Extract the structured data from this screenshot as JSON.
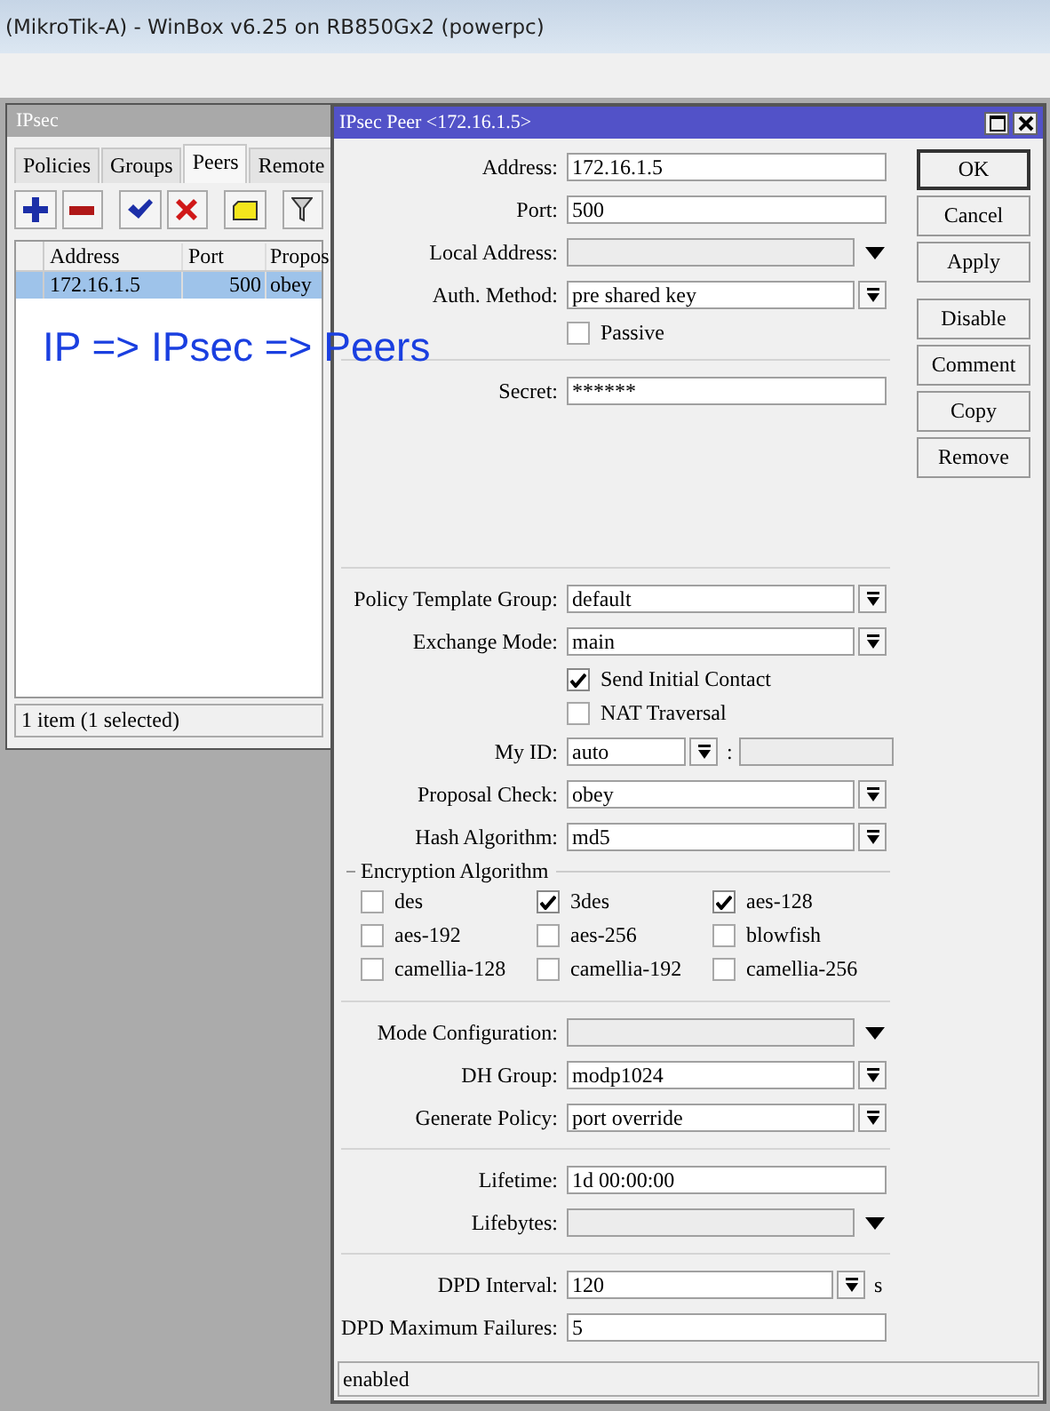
{
  "app_title": "(MikroTik-A) - WinBox v6.25 on RB850Gx2 (powerpc)",
  "ipsec_window": {
    "title": "IPsec",
    "tabs": [
      {
        "label": "Policies",
        "selected": false
      },
      {
        "label": "Groups",
        "selected": false
      },
      {
        "label": "Peers",
        "selected": true
      },
      {
        "label": "Remote",
        "selected": false
      }
    ],
    "columns": [
      "Address",
      "Port",
      "Propos"
    ],
    "rows": [
      {
        "cells": [
          "172.16.1.5",
          "500",
          "obey"
        ],
        "selected": true
      }
    ],
    "status": "1 item (1 selected)"
  },
  "annotation": "IP => IPsec => Peers",
  "peer_dialog": {
    "title": "IPsec Peer <172.16.1.5>",
    "fields": [
      {
        "kind": "input",
        "label": "Address:",
        "value": "172.16.1.5"
      },
      {
        "kind": "input",
        "label": "Port:",
        "value": "500"
      },
      {
        "kind": "combo",
        "label": "Local Address:"
      },
      {
        "kind": "select",
        "label": "Auth. Method:",
        "value": "pre shared key"
      },
      {
        "kind": "check",
        "label": "Passive",
        "checked": false
      },
      {
        "kind": "separator"
      },
      {
        "kind": "input",
        "label": "Secret:",
        "value": "******"
      },
      {
        "kind": "gap"
      },
      {
        "kind": "separator"
      },
      {
        "kind": "select",
        "label": "Policy Template Group:",
        "value": "default"
      },
      {
        "kind": "select",
        "label": "Exchange Mode:",
        "value": "main"
      },
      {
        "kind": "check",
        "label": "Send Initial Contact",
        "checked": true
      },
      {
        "kind": "check",
        "label": "NAT Traversal",
        "checked": false
      },
      {
        "kind": "pair",
        "label": "My ID:",
        "value": "auto",
        "separator": ":"
      },
      {
        "kind": "select",
        "label": "Proposal Check:",
        "value": "obey"
      },
      {
        "kind": "select",
        "label": "Hash Algorithm:",
        "value": "md5"
      },
      {
        "kind": "group",
        "label": "Encryption Algorithm",
        "options": [
          {
            "label": "des",
            "checked": false
          },
          {
            "label": "3des",
            "checked": true
          },
          {
            "label": "aes-128",
            "checked": true
          },
          {
            "label": "aes-192",
            "checked": false
          },
          {
            "label": "aes-256",
            "checked": false
          },
          {
            "label": "blowfish",
            "checked": false
          },
          {
            "label": "camellia-128",
            "checked": false
          },
          {
            "label": "camellia-192",
            "checked": false
          },
          {
            "label": "camellia-256",
            "checked": false
          }
        ]
      },
      {
        "kind": "separator"
      },
      {
        "kind": "combo",
        "label": "Mode Configuration:"
      },
      {
        "kind": "select",
        "label": "DH Group:",
        "value": "modp1024"
      },
      {
        "kind": "select",
        "label": "Generate Policy:",
        "value": "port override"
      },
      {
        "kind": "separator"
      },
      {
        "kind": "input",
        "label": "Lifetime:",
        "value": "1d 00:00:00"
      },
      {
        "kind": "combo",
        "label": "Lifebytes:"
      },
      {
        "kind": "separator"
      },
      {
        "kind": "unit",
        "label": "DPD Interval:",
        "value": "120",
        "unit": "s"
      },
      {
        "kind": "input",
        "label": "DPD Maximum Failures:",
        "value": "5"
      }
    ],
    "button_groups": [
      [
        {
          "label": "OK",
          "default": true
        },
        {
          "label": "Cancel",
          "default": false
        },
        {
          "label": "Apply",
          "default": false
        }
      ],
      [
        {
          "label": "Disable",
          "default": false
        },
        {
          "label": "Comment",
          "default": false
        },
        {
          "label": "Copy",
          "default": false
        },
        {
          "label": "Remove",
          "default": false
        }
      ]
    ],
    "status": "enabled"
  }
}
